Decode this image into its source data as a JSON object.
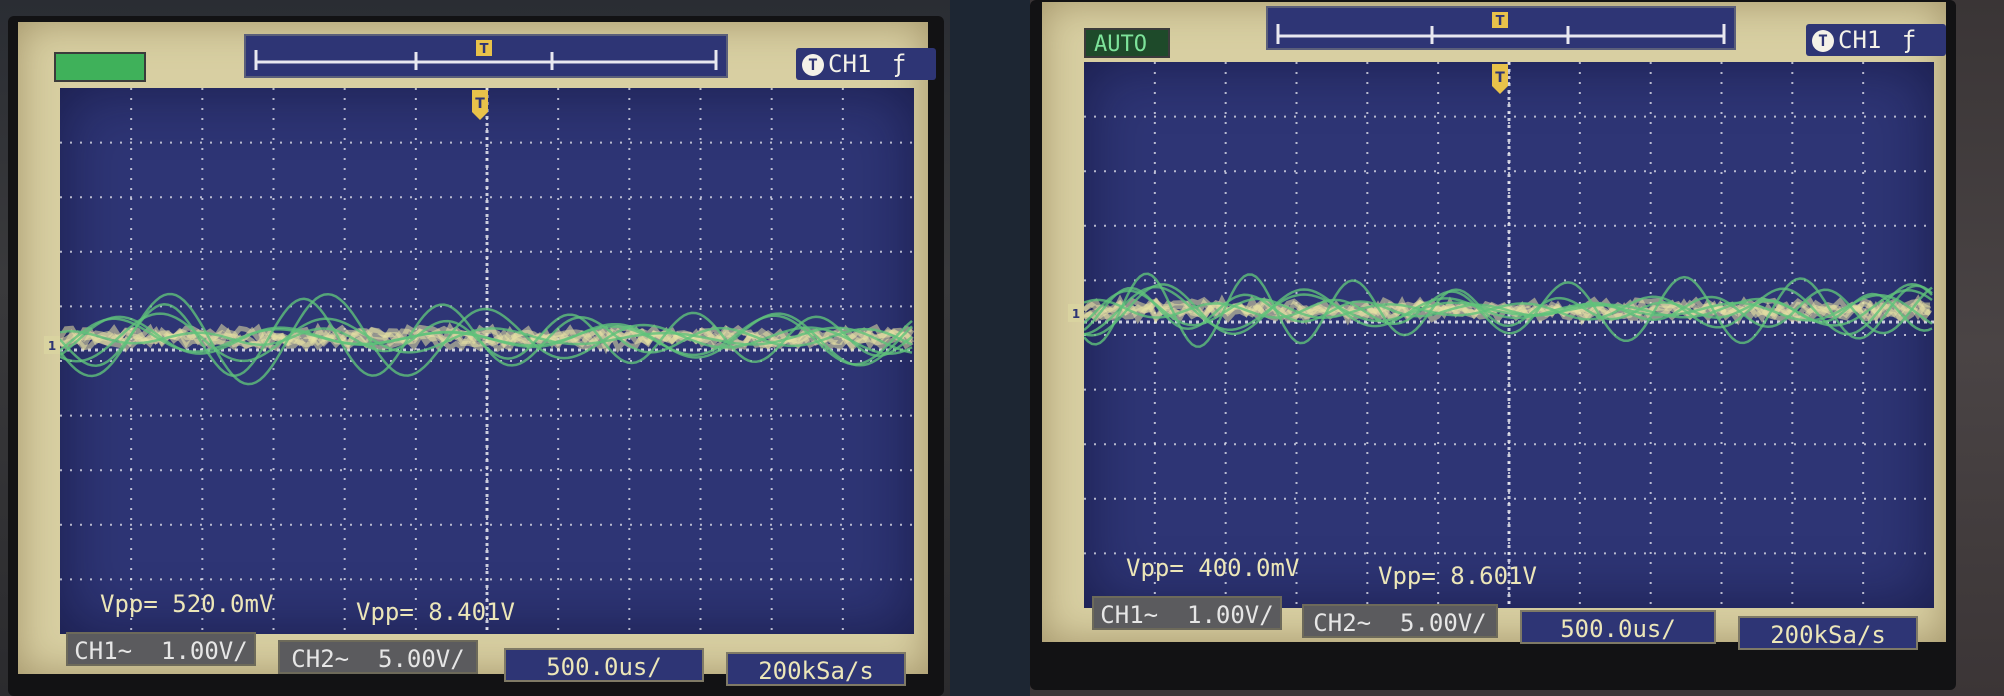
{
  "screens": [
    {
      "mode_label": "",
      "trigger_channel": "CH1",
      "trigger_slope_glyph": "ƒ",
      "vpp_ch1": "Vpp= 520.0mV",
      "vpp_ch2": "Vpp= 8.401V",
      "ch1_scale": "CH1~  1.00V/",
      "ch2_scale": "CH2~  5.00V/",
      "timebase": "500.0us/",
      "sample_rate": "200kSa/s"
    },
    {
      "mode_label": "AUTO",
      "trigger_channel": "CH1",
      "trigger_slope_glyph": "ƒ",
      "vpp_ch1": "Vpp= 400.0mV",
      "vpp_ch2": "Vpp= 8.601V",
      "ch1_scale": "CH1~  1.00V/",
      "ch2_scale": "CH2~  5.00V/",
      "timebase": "500.0us/",
      "sample_rate": "200kSa/s"
    }
  ],
  "colors": {
    "screen_bg": "#2e3575",
    "ch1_trace": "#e8e2a4",
    "ch2_trace": "#5fc27a",
    "grid": "#e8e8f0",
    "mode_green": "#3fb15a",
    "bezel_frame": "#d8cfa2"
  },
  "icons": [
    "trigger-t-icon",
    "trigger-position-marker-icon",
    "ch1-ground-marker-icon",
    "rising-edge-icon"
  ]
}
